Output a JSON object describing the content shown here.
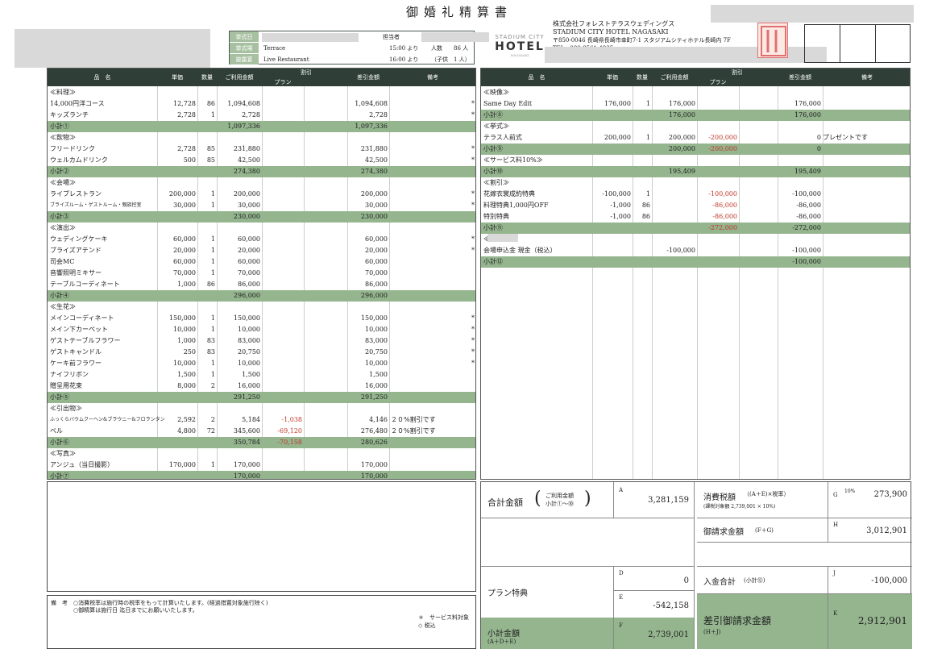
{
  "doc": {
    "title": "御婚礼精算書"
  },
  "info": {
    "labels": [
      "挙式日",
      "挙式場",
      "披露宴"
    ],
    "tantou_label": "担当者",
    "terrace": "Terrace",
    "terrace_time": "15:00 より",
    "ninzu_label": "人数",
    "ninzu": "86 人",
    "live": "Live Restaurant",
    "live_time": "16:00 より",
    "kodomo": "（子供　1 人）"
  },
  "company": {
    "name": "株式会社フォレストテラスウェディングス",
    "hotel": "STADIUM CITY HOTEL NAGASAKI",
    "address": "〒850-0046 長崎県長崎市幸町7-1 スタジアムシティホテル長崎内 7F",
    "tel": "TEL　080-8561-4835",
    "logo_top": "STADIUM CITY",
    "logo_main": "HOTEL",
    "logo_sub": "NAGASAKI"
  },
  "columns": {
    "hinmei": "品　名",
    "tanka": "単価",
    "suryo": "数量",
    "riyou": "ご利用金額",
    "waribiki": "割引",
    "plan": "プラン",
    "sabiki": "差引金額",
    "biko": "備考"
  },
  "left_rows": [
    [
      "≪料理≫",
      "",
      "",
      "",
      "",
      "",
      "",
      ""
    ],
    [
      "14,000円洋コース",
      "12,728",
      "86",
      "1,094,608",
      "",
      "1,094,608",
      "",
      "*"
    ],
    [
      "キッズランチ",
      "2,728",
      "1",
      "2,728",
      "",
      "2,728",
      "",
      "*"
    ],
    [
      "小計①",
      "",
      "",
      "1,097,336",
      "",
      "1,097,336",
      "",
      "S"
    ],
    [
      "≪飲物≫",
      "",
      "",
      "",
      "",
      "",
      "",
      ""
    ],
    [
      "フリードリンク",
      "2,728",
      "85",
      "231,880",
      "",
      "231,880",
      "",
      "*"
    ],
    [
      "ウェルカムドリンク",
      "500",
      "85",
      "42,500",
      "",
      "42,500",
      "",
      "*"
    ],
    [
      "小計②",
      "",
      "",
      "274,380",
      "",
      "274,380",
      "",
      "S"
    ],
    [
      "≪会場≫",
      "",
      "",
      "",
      "",
      "",
      "",
      ""
    ],
    [
      "ライブレストラン",
      "200,000",
      "1",
      "200,000",
      "",
      "200,000",
      "",
      "*"
    ],
    [
      "ブライズルーム・ゲストルーム・親族控室",
      "30,000",
      "1",
      "30,000",
      "",
      "30,000",
      "",
      "*"
    ],
    [
      "小計③",
      "",
      "",
      "230,000",
      "",
      "230,000",
      "",
      "S"
    ],
    [
      "≪演出≫",
      "",
      "",
      "",
      "",
      "",
      "",
      ""
    ],
    [
      "ウェディングケーキ",
      "60,000",
      "1",
      "60,000",
      "",
      "60,000",
      "",
      "*"
    ],
    [
      "ブライズアテンド",
      "20,000",
      "1",
      "20,000",
      "",
      "20,000",
      "",
      "*"
    ],
    [
      "司会MC",
      "60,000",
      "1",
      "60,000",
      "",
      "60,000",
      "",
      ""
    ],
    [
      "音響照明ミキサー",
      "70,000",
      "1",
      "70,000",
      "",
      "70,000",
      "",
      ""
    ],
    [
      "テーブルコーディネート",
      "1,000",
      "86",
      "86,000",
      "",
      "86,000",
      "",
      ""
    ],
    [
      "小計④",
      "",
      "",
      "296,000",
      "",
      "296,000",
      "",
      "S"
    ],
    [
      "≪生花≫",
      "",
      "",
      "",
      "",
      "",
      "",
      ""
    ],
    [
      "メインコーディネート",
      "150,000",
      "1",
      "150,000",
      "",
      "150,000",
      "",
      "*"
    ],
    [
      "メイン下カーペット",
      "10,000",
      "1",
      "10,000",
      "",
      "10,000",
      "",
      "*"
    ],
    [
      "ゲストテーブルフラワー",
      "1,000",
      "83",
      "83,000",
      "",
      "83,000",
      "",
      "*"
    ],
    [
      "ゲストキャンドル",
      "250",
      "83",
      "20,750",
      "",
      "20,750",
      "",
      "*"
    ],
    [
      "ケーキ前フラワー",
      "10,000",
      "1",
      "10,000",
      "",
      "10,000",
      "",
      "*"
    ],
    [
      "ナイフリボン",
      "1,500",
      "1",
      "1,500",
      "",
      "1,500",
      "",
      ""
    ],
    [
      "贈呈用花束",
      "8,000",
      "2",
      "16,000",
      "",
      "16,000",
      "",
      ""
    ],
    [
      "小計⑤",
      "",
      "",
      "291,250",
      "",
      "291,250",
      "",
      "S"
    ],
    [
      "≪引出物≫",
      "",
      "",
      "",
      "",
      "",
      "",
      ""
    ],
    [
      "ふっくらバウムクーヘン&ブラウニー&フロランタン",
      "2,592",
      "2",
      "5,184",
      "-1,038",
      "4,146",
      "２０%割引です",
      ""
    ],
    [
      "ベル",
      "4,800",
      "72",
      "345,600",
      "-69,120",
      "276,480",
      "２０%割引です",
      ""
    ],
    [
      "小計⑥",
      "",
      "",
      "350,784",
      "-70,158",
      "280,626",
      "",
      "S"
    ],
    [
      "≪写真≫",
      "",
      "",
      "",
      "",
      "",
      "",
      ""
    ],
    [
      "アンジュ（当日撮影）",
      "170,000",
      "1",
      "170,000",
      "",
      "170,000",
      "",
      ""
    ],
    [
      "小計⑦",
      "",
      "",
      "170,000",
      "",
      "170,000",
      "",
      "S"
    ]
  ],
  "right_rows": [
    [
      "≪映像≫",
      "",
      "",
      "",
      "",
      "",
      "",
      ""
    ],
    [
      "Same Day Edit",
      "176,000",
      "1",
      "176,000",
      "",
      "176,000",
      "",
      ""
    ],
    [
      "小計⑧",
      "",
      "",
      "176,000",
      "",
      "176,000",
      "",
      "S"
    ],
    [
      "≪挙式≫",
      "",
      "",
      "",
      "",
      "",
      "",
      ""
    ],
    [
      "テラス人前式",
      "200,000",
      "1",
      "200,000",
      "-200,000",
      "0",
      "プレゼントです",
      ""
    ],
    [
      "小計⑨",
      "",
      "",
      "200,000",
      "-200,000",
      "0",
      "",
      "S"
    ],
    [
      "≪サービス料10%≫",
      "",
      "",
      "",
      "",
      "",
      "",
      ""
    ],
    [
      "小計⑩",
      "",
      "",
      "195,409",
      "",
      "195,409",
      "",
      "S"
    ],
    [
      "≪割引≫",
      "",
      "",
      "",
      "",
      "",
      "",
      ""
    ],
    [
      "花嫁衣裳成約特典",
      "-100,000",
      "1",
      "",
      "-100,000",
      "-100,000",
      "",
      ""
    ],
    [
      "料理特典1,000円OFF",
      "-1,000",
      "86",
      "",
      "-86,000",
      "-86,000",
      "",
      ""
    ],
    [
      "特別特典",
      "-1,000",
      "86",
      "",
      "-86,000",
      "-86,000",
      "",
      ""
    ],
    [
      "小計⑪",
      "",
      "",
      "",
      "-272,000",
      "-272,000",
      "",
      "S"
    ],
    [
      "≪ご入金≫",
      "",
      "",
      "",
      "",
      "",
      "",
      ""
    ],
    [
      "会場申込金 現金（税込）",
      "",
      "",
      "-100,000",
      "",
      "-100,000",
      "",
      ""
    ],
    [
      "小計⑫",
      "",
      "",
      "",
      "",
      "-100,000",
      "",
      "S"
    ]
  ],
  "totals": {
    "goukei_label": "合計金額",
    "goukei_note1": "ご利用金額",
    "goukei_note2": "小計①～⑩",
    "A_label": "A",
    "A": "3,281,159",
    "plan_label": "プラン特典",
    "D_label": "D",
    "D": "0",
    "E_label": "E",
    "E": "-542,158",
    "shokei_label": "小計金額",
    "shokei_note": "(A＋D＋E)",
    "F_label": "F",
    "F": "2,739,001",
    "tax_label": "消費税額",
    "tax_formula": "（(A＋E)×税率）",
    "tax_detail": "(課税対象額 2,739,001 × 10%)",
    "G_label": "G",
    "G_rate": "10%",
    "G": "273,900",
    "seikyu_label": "御請求金額",
    "seikyu_note": "(F＋G)",
    "H_label": "H",
    "H": "3,012,901",
    "nyukin_label": "入金合計",
    "nyukin_note": "(小計⑫)",
    "J_label": "J",
    "J": "-100,000",
    "sabiki_label": "差引御請求金額",
    "sabiki_note": "(H＋J)",
    "K_label": "K",
    "K": "2,912,901"
  },
  "notes": {
    "label": "備　考",
    "line1": "○消費税率は施行時の税率をもって計算いたします。(経過措置対象施行除く)",
    "line2": "○御精算は施行日 迄日までにお願いいたします。",
    "legend1": "＊　サービス料対象",
    "legend2": "◇ 税込"
  }
}
